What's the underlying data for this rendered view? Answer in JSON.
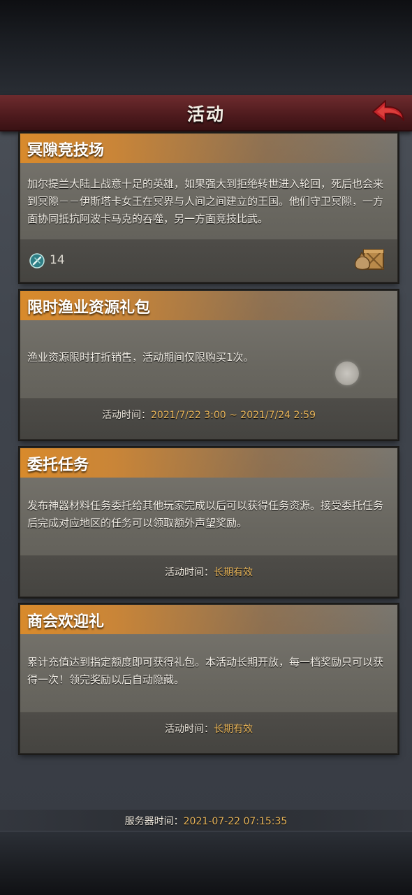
{
  "header": {
    "title": "活动"
  },
  "cards": [
    {
      "title": "冥隙竞技场",
      "description": "加尔提兰大陆上战意十足的英雄，如果强大到拒绝转世进入轮回，死后也会来到冥隙－－伊斯塔卡女王在冥界与人间之间建立的王国。他们守卫冥隙，一方面协同抵抗阿波卡马克的吞噬，另一方面竞技比武。",
      "ticket_count": "14"
    },
    {
      "title": "限时渔业资源礼包",
      "description": "渔业资源限时打折销售，活动期间仅限购买1次。",
      "time_label": "活动时间：",
      "time_value": "2021/7/22 3:00 ~ 2021/7/24 2:59"
    },
    {
      "title": "委托任务",
      "description": "发布神器材料任务委托给其他玩家完成以后可以获得任务资源。接受委托任务后完成对应地区的任务可以领取额外声望奖励。",
      "time_label": "活动时间：",
      "time_value": "长期有效"
    },
    {
      "title": "商会欢迎礼",
      "description": "累计充值达到指定额度即可获得礼包。本活动长期开放，每一档奖励只可以获得一次！领完奖励以后自动隐藏。",
      "time_label": "活动时间：",
      "time_value": "长期有效"
    }
  ],
  "server": {
    "label": "服务器时间：",
    "value": "2021-07-22 07:15:35"
  },
  "colors": {
    "header_bg": "#5a1f22",
    "title_bar": "#d88a2c",
    "highlight_text": "#e8b55a"
  },
  "icons": {
    "back": "back-arrow-icon",
    "ticket": "arena-ticket-icon",
    "reward": "reward-bag-crate-icon"
  }
}
